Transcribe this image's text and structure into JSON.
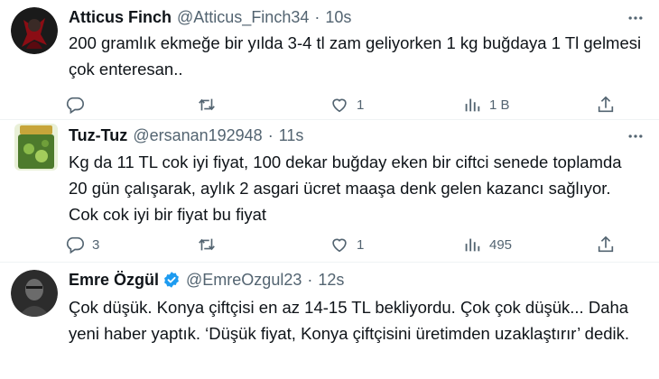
{
  "tweets": [
    {
      "name": "Atticus Finch",
      "handle": "@Atticus_Finch34",
      "time": "10s",
      "separator": "·",
      "text": "200 gramlık ekmeğe bir yılda 3-4 tl zam geliyorken 1 kg buğdaya 1 Tl gelmesi çok enteresan..",
      "replies": "",
      "retweets": "",
      "likes": "1",
      "views": "1 B",
      "verified": false
    },
    {
      "name": "Tuz-Tuz",
      "handle": "@ersanan192948",
      "time": "11s",
      "separator": "·",
      "text": "Kg da 11 TL cok iyi fiyat, 100 dekar buğday eken bir ciftci senede toplamda 20 gün çalışarak, aylık 2 asgari ücret maaşa denk gelen kazancı sağlıyor. Cok cok iyi bir fiyat bu fiyat",
      "replies": "3",
      "retweets": "",
      "likes": "1",
      "views": "495",
      "verified": false
    },
    {
      "name": "Emre Özgül",
      "handle": "@EmreOzgul23",
      "time": "12s",
      "separator": "·",
      "text": "Çok düşük. Konya çiftçisi en az 14-15 TL bekliyordu. Çok çok düşük... Daha yeni haber yaptık. ‘Düşük fiyat, Konya çiftçisini üretimden uzaklaştırır’ dedik.",
      "verified": true
    }
  ],
  "colors": {
    "text": "#0f1419",
    "secondary": "#536471",
    "verified": "#1d9bf0",
    "divider": "#eff3f4"
  },
  "icons": [
    "reply-icon",
    "retweet-icon",
    "like-icon",
    "views-icon",
    "share-icon",
    "more-icon",
    "verified-badge-icon"
  ]
}
